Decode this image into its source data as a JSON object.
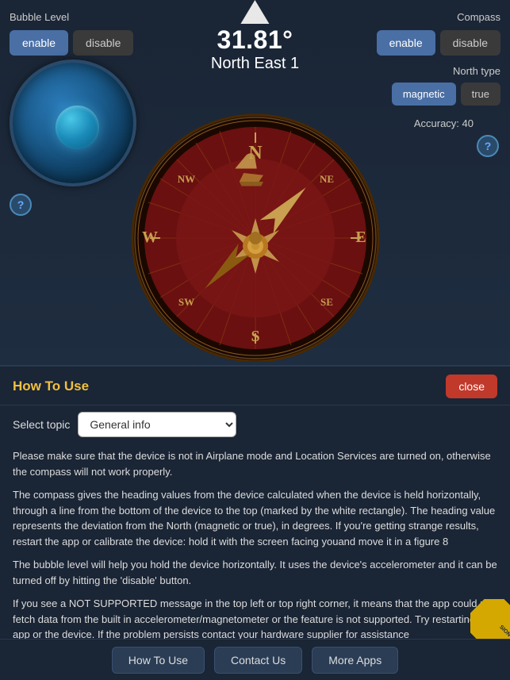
{
  "bubble": {
    "label": "Bubble Level",
    "enable_label": "enable",
    "disable_label": "disable"
  },
  "heading": {
    "value": "31.81°",
    "direction": "North East 1"
  },
  "compass": {
    "label": "Compass",
    "enable_label": "enable",
    "disable_label": "disable",
    "north_type_label": "North type",
    "magnetic_label": "magnetic",
    "true_label": "true",
    "accuracy_label": "Accuracy: 40"
  },
  "how_to_use": {
    "title": "How To Use",
    "close_label": "close",
    "select_topic_label": "Select topic",
    "topic_value": "General info",
    "paragraphs": [
      "Please make sure that the device is not in Airplane mode and Location Services are turned on, otherwise the compass will not work properly.",
      "The compass gives the heading values from the device calculated when the device is held horizontally, through a line from the bottom of the device to the top (marked by the white rectangle). The heading value represents the deviation from the North (magnetic or true), in degrees. If you're getting strange results, restart the app or calibrate the device: hold it with the screen facing youand move it in a figure 8",
      "The bubble level will help you hold the device horizontally. It uses the device's accelerometer and it can be turned off by hitting the 'disable' button.",
      "If you see a NOT SUPPORTED message in the top left or top right corner, it means that the app could not fetch data from the built in accelerometer/magnetometer or the feature is not supported. Try restarting the app or the device. If the problem persists contact your hardware supplier for assistance"
    ]
  },
  "footer": {
    "how_to_use_label": "How To Use",
    "contact_us_label": "Contact Us",
    "more_apps_label": "More Apps"
  },
  "help_icon": "?",
  "badge_text": "SION"
}
